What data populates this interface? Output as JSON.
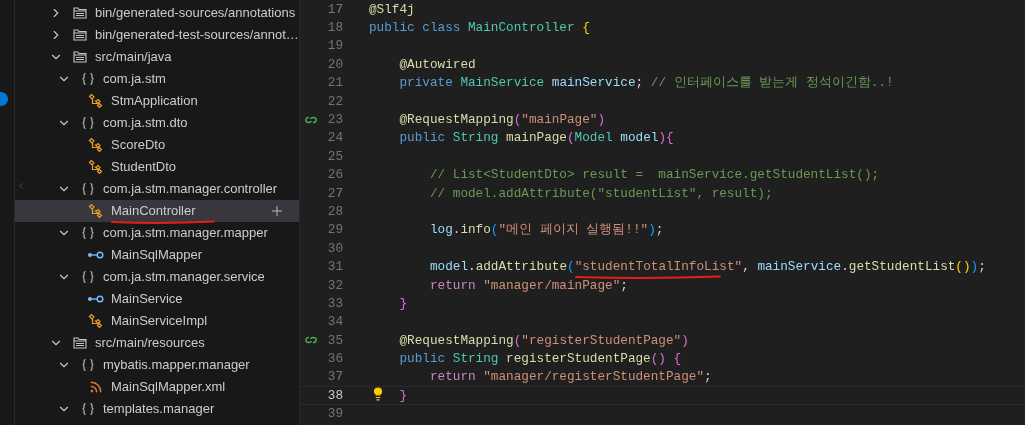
{
  "tree": [
    {
      "kind": "folder",
      "label": "bin/generated-sources/annotations",
      "expanded": false,
      "selected": false
    },
    {
      "kind": "folder",
      "label": "bin/generated-test-sources/annot…",
      "expanded": false,
      "selected": false
    },
    {
      "kind": "folder",
      "label": "src/main/java",
      "expanded": true,
      "selected": false,
      "children": [
        {
          "kind": "package",
          "label": "com.ja.stm",
          "expanded": true,
          "selected": false,
          "children": [
            {
              "kind": "class",
              "label": "StmApplication",
              "selected": false
            }
          ]
        },
        {
          "kind": "package",
          "label": "com.ja.stm.dto",
          "expanded": true,
          "selected": false,
          "children": [
            {
              "kind": "class",
              "label": "ScoreDto",
              "selected": false
            },
            {
              "kind": "class",
              "label": "StudentDto",
              "selected": false
            }
          ]
        },
        {
          "kind": "package",
          "label": "com.ja.stm.manager.controller",
          "expanded": true,
          "selected": false,
          "children": [
            {
              "kind": "class",
              "label": "MainController",
              "selected": true,
              "underlined": true
            }
          ]
        },
        {
          "kind": "package",
          "label": "com.ja.stm.manager.mapper",
          "expanded": true,
          "selected": false,
          "children": [
            {
              "kind": "interface",
              "label": "MainSqlMapper",
              "selected": false
            }
          ]
        },
        {
          "kind": "package",
          "label": "com.ja.stm.manager.service",
          "expanded": true,
          "selected": false,
          "children": [
            {
              "kind": "interface",
              "label": "MainService",
              "selected": false
            },
            {
              "kind": "class",
              "label": "MainServiceImpl",
              "selected": false
            }
          ]
        }
      ]
    },
    {
      "kind": "folder",
      "label": "src/main/resources",
      "expanded": true,
      "selected": false,
      "children": [
        {
          "kind": "package",
          "label": "mybatis.mapper.manager",
          "expanded": true,
          "selected": false,
          "children": [
            {
              "kind": "xml",
              "label": "MainSqlMapper.xml",
              "selected": false
            }
          ]
        },
        {
          "kind": "package",
          "label": "templates.manager",
          "expanded": true,
          "selected": false
        }
      ]
    }
  ],
  "editor": {
    "lines": [
      {
        "number": "17",
        "current": false,
        "tokens": [
          {
            "kind": "ann",
            "text": "@Slf4j"
          }
        ]
      },
      {
        "number": "18",
        "current": false,
        "tokens": [
          {
            "kind": "kw",
            "text": "public class "
          },
          {
            "kind": "type",
            "text": "MainController "
          },
          {
            "kind": "b1",
            "text": "{"
          }
        ]
      },
      {
        "number": "19",
        "current": false
      },
      {
        "number": "20",
        "current": false,
        "tokens": [
          {
            "kind": "ann",
            "text": "    @Autowired"
          }
        ]
      },
      {
        "number": "21",
        "current": false,
        "tokens": [
          {
            "kind": "kw",
            "text": "    private "
          },
          {
            "kind": "type",
            "text": "MainService "
          },
          {
            "kind": "var",
            "text": "mainService"
          },
          {
            "kind": "plain",
            "text": "; "
          },
          {
            "kind": "cmt",
            "text": "// 인터페이스를 받는게 정석이긴함..!"
          }
        ]
      },
      {
        "number": "22",
        "current": false
      },
      {
        "number": "23",
        "current": false,
        "spring_marker": true,
        "tokens": [
          {
            "kind": "ann",
            "text": "    @RequestMapping"
          },
          {
            "kind": "b2",
            "text": "("
          },
          {
            "kind": "str",
            "text": "\"mainPage\""
          },
          {
            "kind": "b2",
            "text": ")"
          }
        ]
      },
      {
        "number": "24",
        "current": false,
        "tokens": [
          {
            "kind": "kw",
            "text": "    public "
          },
          {
            "kind": "type",
            "text": "String "
          },
          {
            "kind": "fn",
            "text": "mainPage"
          },
          {
            "kind": "b2",
            "text": "("
          },
          {
            "kind": "type",
            "text": "Model "
          },
          {
            "kind": "var",
            "text": "model"
          },
          {
            "kind": "b2",
            "text": "){"
          }
        ]
      },
      {
        "number": "25",
        "current": false
      },
      {
        "number": "26",
        "current": false,
        "tokens": [
          {
            "kind": "cmt",
            "text": "        // List<StudentDto> result =  mainService.getStudentList();"
          }
        ]
      },
      {
        "number": "27",
        "current": false,
        "tokens": [
          {
            "kind": "cmt",
            "text": "        // model.addAttribute(\"studentList\", result);"
          }
        ]
      },
      {
        "number": "28",
        "current": false
      },
      {
        "number": "29",
        "current": false,
        "tokens": [
          {
            "kind": "var",
            "text": "        log"
          },
          {
            "kind": "plain",
            "text": "."
          },
          {
            "kind": "fn",
            "text": "info"
          },
          {
            "kind": "b3",
            "text": "("
          },
          {
            "kind": "str",
            "text": "\"메인 페이지 실행됨!!\""
          },
          {
            "kind": "b3",
            "text": ")"
          },
          {
            "kind": "plain",
            "text": ";"
          }
        ]
      },
      {
        "number": "30",
        "current": false
      },
      {
        "number": "31",
        "current": false,
        "tokens": [
          {
            "kind": "var",
            "text": "        model"
          },
          {
            "kind": "plain",
            "text": "."
          },
          {
            "kind": "fn",
            "text": "addAttribute"
          },
          {
            "kind": "b3",
            "text": "("
          },
          {
            "kind": "str",
            "text": "\"studentTotalInfoList\"",
            "underlined": true
          },
          {
            "kind": "plain",
            "text": ", "
          },
          {
            "kind": "var",
            "text": "mainService"
          },
          {
            "kind": "plain",
            "text": "."
          },
          {
            "kind": "fn",
            "text": "getStudentList"
          },
          {
            "kind": "b1",
            "text": "()"
          },
          {
            "kind": "b3",
            "text": ")"
          },
          {
            "kind": "plain",
            "text": ";"
          }
        ]
      },
      {
        "number": "32",
        "current": false,
        "tokens": [
          {
            "kind": "ctrl",
            "text": "        return "
          },
          {
            "kind": "str",
            "text": "\"manager/mainPage\""
          },
          {
            "kind": "plain",
            "text": ";"
          }
        ]
      },
      {
        "number": "33",
        "current": false,
        "tokens": [
          {
            "kind": "b2",
            "text": "    }"
          }
        ]
      },
      {
        "number": "34",
        "current": false
      },
      {
        "number": "35",
        "current": false,
        "spring_marker": true,
        "tokens": [
          {
            "kind": "ann",
            "text": "    @RequestMapping"
          },
          {
            "kind": "b2",
            "text": "("
          },
          {
            "kind": "str",
            "text": "\"registerStudentPage\""
          },
          {
            "kind": "b2",
            "text": ")"
          }
        ]
      },
      {
        "number": "36",
        "current": false,
        "tokens": [
          {
            "kind": "kw",
            "text": "    public "
          },
          {
            "kind": "type",
            "text": "String "
          },
          {
            "kind": "fn",
            "text": "registerStudentPage"
          },
          {
            "kind": "b2",
            "text": "() {"
          }
        ]
      },
      {
        "number": "37",
        "current": false,
        "tokens": [
          {
            "kind": "ctrl",
            "text": "        return "
          },
          {
            "kind": "str",
            "text": "\"manager/registerStudentPage\""
          },
          {
            "kind": "plain",
            "text": ";"
          }
        ]
      },
      {
        "number": "38",
        "current": true,
        "bulb": true,
        "tokens": [
          {
            "kind": "b2",
            "text": "    }"
          }
        ]
      },
      {
        "number": "39",
        "current": false
      }
    ]
  }
}
